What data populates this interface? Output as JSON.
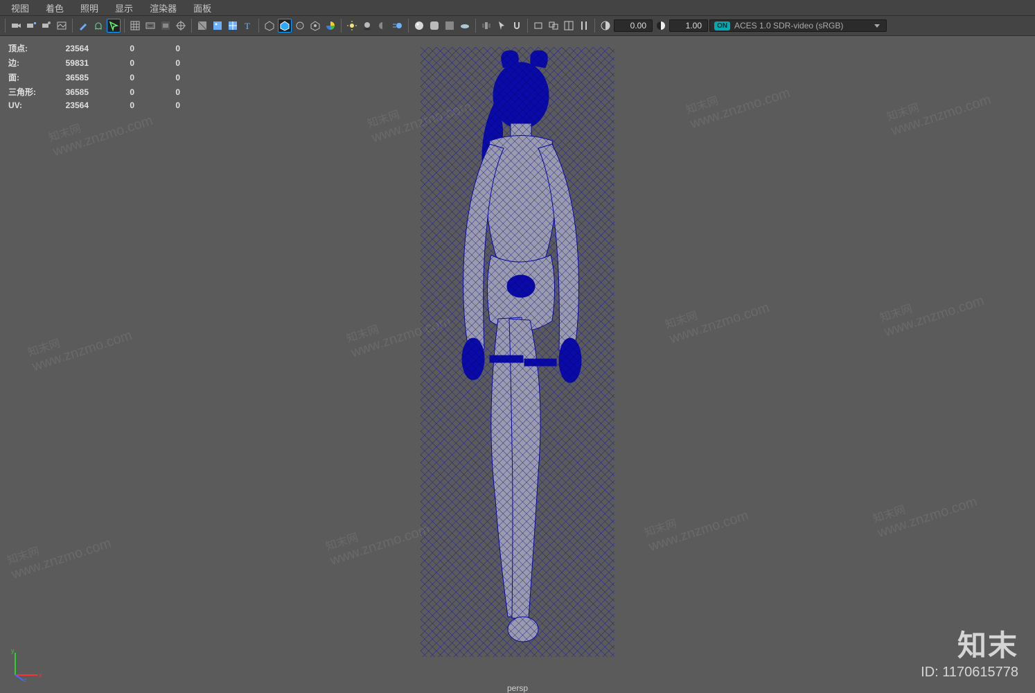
{
  "menubar": {
    "items": [
      "视图",
      "着色",
      "照明",
      "显示",
      "渲染器",
      "面板"
    ]
  },
  "toolbar": {
    "field_a": "0.00",
    "field_b": "1.00",
    "color_mgmt_badge": "ON",
    "color_mgmt": "ACES 1.0 SDR-video (sRGB)"
  },
  "hud": {
    "rows": [
      {
        "label": "顶点:",
        "c1": "23564",
        "c2": "0",
        "c3": "0"
      },
      {
        "label": "边:",
        "c1": "59831",
        "c2": "0",
        "c3": "0"
      },
      {
        "label": "面:",
        "c1": "36585",
        "c2": "0",
        "c3": "0"
      },
      {
        "label": "三角形:",
        "c1": "36585",
        "c2": "0",
        "c3": "0"
      },
      {
        "label": "UV:",
        "c1": "23564",
        "c2": "0",
        "c3": "0"
      }
    ]
  },
  "camera_label": "persp",
  "axis": {
    "x": "x",
    "y": "y",
    "z": "z"
  },
  "watermark": {
    "brand": "知末",
    "id_label": "ID: 1170615778",
    "repeat_cn": "知末网",
    "repeat_url": "www.znzmo.com"
  }
}
